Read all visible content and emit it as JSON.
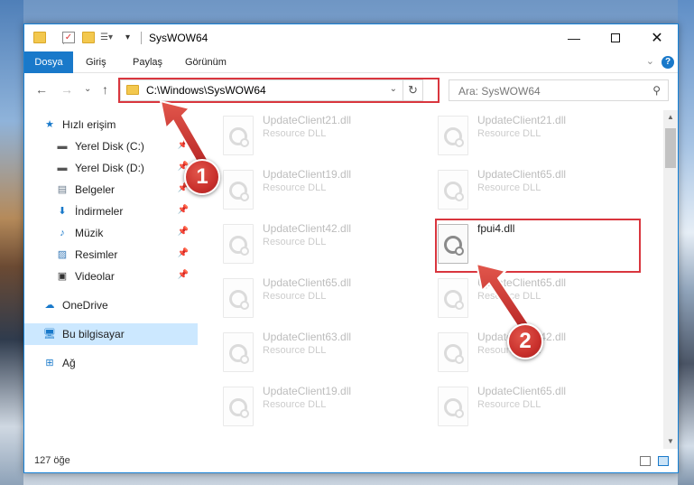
{
  "window": {
    "title": "SysWOW64"
  },
  "ribbon": {
    "tabs": [
      "Dosya",
      "Giriş",
      "Paylaş",
      "Görünüm"
    ],
    "active_tab": "Dosya",
    "help": "?"
  },
  "navigation": {
    "back": "←",
    "forward": "→",
    "recent": "⌄",
    "up": "↑"
  },
  "address": {
    "path": "C:\\Windows\\SysWOW64",
    "refresh": "↻"
  },
  "search": {
    "placeholder": "Ara: SysWOW64"
  },
  "sidebar": {
    "items": [
      {
        "label": "Hızlı erişim",
        "icon": "star-icon"
      },
      {
        "label": "Yerel Disk (C:)",
        "icon": "drive-icon",
        "pinned": true
      },
      {
        "label": "Yerel Disk (D:)",
        "icon": "drive-icon",
        "pinned": true
      },
      {
        "label": "Belgeler",
        "icon": "document-icon",
        "pinned": true
      },
      {
        "label": "İndirmeler",
        "icon": "download-icon",
        "pinned": true
      },
      {
        "label": "Müzik",
        "icon": "music-icon",
        "pinned": true
      },
      {
        "label": "Resimler",
        "icon": "picture-icon",
        "pinned": true
      },
      {
        "label": "Videolar",
        "icon": "video-icon",
        "pinned": true
      },
      {
        "label": "OneDrive",
        "icon": "cloud-icon"
      },
      {
        "label": "Bu bilgisayar",
        "icon": "computer-icon",
        "selected": true
      },
      {
        "label": "Ağ",
        "icon": "network-icon"
      }
    ]
  },
  "files": [
    {
      "name": "UpdateClient21.dll",
      "type": "Resource DLL",
      "faded": true
    },
    {
      "name": "UpdateClient21.dll",
      "type": "Resource DLL",
      "faded": true
    },
    {
      "name": "UpdateClient19.dll",
      "type": "Resource DLL",
      "faded": true
    },
    {
      "name": "UpdateClient65.dll",
      "type": "Resource DLL",
      "faded": true
    },
    {
      "name": "UpdateClient42.dll",
      "type": "Resource DLL",
      "faded": true
    },
    {
      "name": "fpui4.dll",
      "type": "",
      "faded": false
    },
    {
      "name": "UpdateClient65.dll",
      "type": "Resource DLL",
      "faded": true
    },
    {
      "name": "UpdateClient65.dll",
      "type": "Resource DLL",
      "faded": true
    },
    {
      "name": "UpdateClient63.dll",
      "type": "Resource DLL",
      "faded": true
    },
    {
      "name": "UpdateClient42.dll",
      "type": "Resource DLL",
      "faded": true
    },
    {
      "name": "UpdateClient19.dll",
      "type": "Resource DLL",
      "faded": true
    },
    {
      "name": "UpdateClient65.dll",
      "type": "Resource DLL",
      "faded": true
    }
  ],
  "status": {
    "item_count": "127 öğe"
  },
  "annotations": {
    "step1": "1",
    "step2": "2",
    "highlight_color": "#d9363e"
  }
}
